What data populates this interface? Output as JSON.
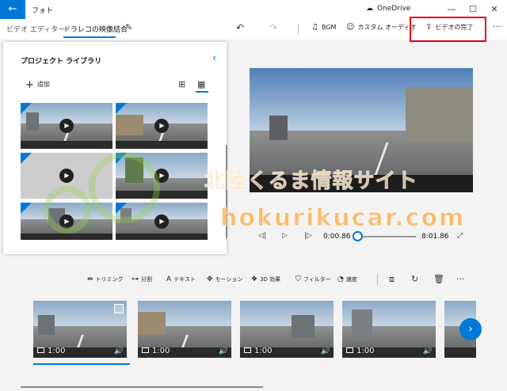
{
  "titlebar": {
    "back_label": "←",
    "app_title": "フォト",
    "onedrive_label": "OneDrive",
    "minimize": "—",
    "maximize": "☐",
    "close": "✕"
  },
  "toolbar": {
    "breadcrumb_root": "ビデオ エディター",
    "breadcrumb_sep": "›",
    "project_name": "ドラレコの映像結合",
    "undo_icon": "↶",
    "redo_icon": "↷",
    "bgm_label": "BGM",
    "custom_audio_label": "カスタム オーディオ",
    "finish_label": "ビデオの完了",
    "more": "···",
    "highlight_color": "#e60012"
  },
  "library": {
    "title": "プロジェクト ライブラリ",
    "add_label": "追加",
    "collapse_icon": "‹",
    "view_grid_small": "⊞",
    "view_grid_large": "▦"
  },
  "preview": {
    "current_time": "0:00.86",
    "total_time": "8:01.86",
    "progress": 0.0018
  },
  "watermark": {
    "line1": "北陸くるま情報サイト",
    "line2": "hokurikucar.com"
  },
  "storyboard_toolbar": {
    "trim": "トリミング",
    "split": "分割",
    "text": "テキスト",
    "motion": "モーション",
    "effects3d": "3D 効果",
    "filter": "フィルター",
    "speed": "速度",
    "more": "···"
  },
  "storyboard": {
    "cards": [
      {
        "duration": "1:00"
      },
      {
        "duration": "1:00"
      },
      {
        "duration": "1:00"
      },
      {
        "duration": "1:00"
      }
    ]
  },
  "accent_color": "#0078d7"
}
